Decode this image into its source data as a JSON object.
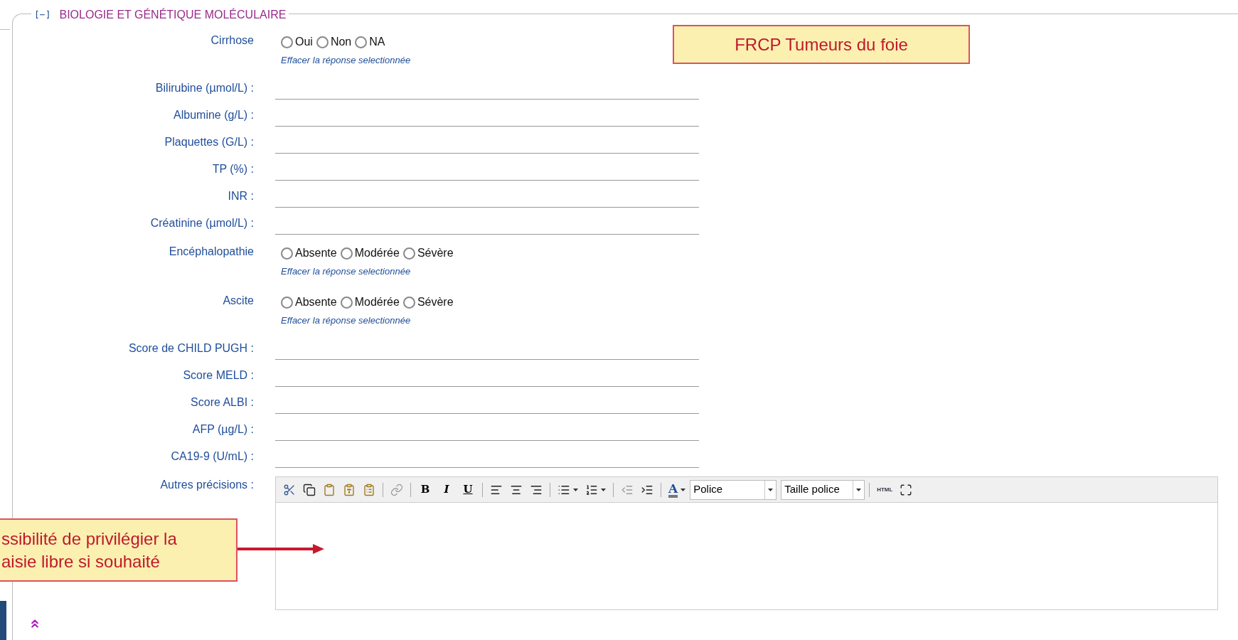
{
  "section": {
    "toggle": "[−]",
    "title": "BIOLOGIE ET GÉNÉTIQUE MOLÉCULAIRE"
  },
  "fields": [
    {
      "kind": "radio",
      "label": "Cirrhose",
      "options": [
        {
          "label": "Oui",
          "selected": false
        },
        {
          "label": "Non",
          "selected": false
        },
        {
          "label": "NA",
          "selected": false
        }
      ],
      "clear": "Effacer la réponse selectionnée"
    },
    {
      "kind": "text",
      "label": "Bilirubine (µmol/L) :"
    },
    {
      "kind": "text",
      "label": "Albumine (g/L) :"
    },
    {
      "kind": "text",
      "label": "Plaquettes (G/L) :"
    },
    {
      "kind": "text",
      "label": "TP (%) :"
    },
    {
      "kind": "text",
      "label": "INR :"
    },
    {
      "kind": "text",
      "label": "Créatinine (µmol/L) :"
    },
    {
      "kind": "radio",
      "label": "Encéphalopathie",
      "options": [
        {
          "label": "Absente",
          "selected": false
        },
        {
          "label": "Modérée",
          "selected": false
        },
        {
          "label": "Sévère",
          "selected": false
        }
      ],
      "clear": "Effacer la réponse selectionnée"
    },
    {
      "kind": "radio",
      "label": "Ascite",
      "options": [
        {
          "label": "Absente",
          "selected": false
        },
        {
          "label": "Modérée",
          "selected": false
        },
        {
          "label": "Sévère",
          "selected": false
        }
      ],
      "clear": "Effacer la réponse selectionnée"
    },
    {
      "kind": "text",
      "label": "Score de CHILD PUGH :"
    },
    {
      "kind": "text",
      "label": "Score MELD :"
    },
    {
      "kind": "text",
      "label": "Score ALBI :"
    },
    {
      "kind": "text",
      "label": "AFP (µg/L) :"
    },
    {
      "kind": "text",
      "label": "CA19-9 (U/mL) :"
    },
    {
      "kind": "editor",
      "label": "Autres précisions :"
    }
  ],
  "toolbar": [
    {
      "kind": "cut"
    },
    {
      "kind": "copy"
    },
    {
      "kind": "paste"
    },
    {
      "kind": "paste-text"
    },
    {
      "kind": "paste-word"
    },
    {
      "kind": "sep"
    },
    {
      "kind": "link",
      "disabled": true
    },
    {
      "kind": "sep"
    },
    {
      "kind": "bold",
      "label": "B"
    },
    {
      "kind": "italic",
      "label": "I"
    },
    {
      "kind": "underline",
      "label": "U"
    },
    {
      "kind": "sep"
    },
    {
      "kind": "align-left"
    },
    {
      "kind": "align-center"
    },
    {
      "kind": "align-right"
    },
    {
      "kind": "sep"
    },
    {
      "kind": "bullets"
    },
    {
      "kind": "numbers"
    },
    {
      "kind": "sep"
    },
    {
      "kind": "outdent",
      "disabled": true
    },
    {
      "kind": "indent",
      "disabled": false
    },
    {
      "kind": "sep"
    },
    {
      "kind": "color",
      "label": "A"
    },
    {
      "kind": "select",
      "label": "Police"
    },
    {
      "kind": "select",
      "label": "Taille police"
    },
    {
      "kind": "sep"
    },
    {
      "kind": "html",
      "label": "HTML"
    },
    {
      "kind": "fullscreen"
    }
  ],
  "callouts": [
    {
      "kind": "title",
      "lines": [
        "FRCP Tumeurs du foie"
      ]
    },
    {
      "kind": "note",
      "lines": [
        "ssibilité de privilégier la",
        "aisie libre si souhaité"
      ]
    }
  ]
}
